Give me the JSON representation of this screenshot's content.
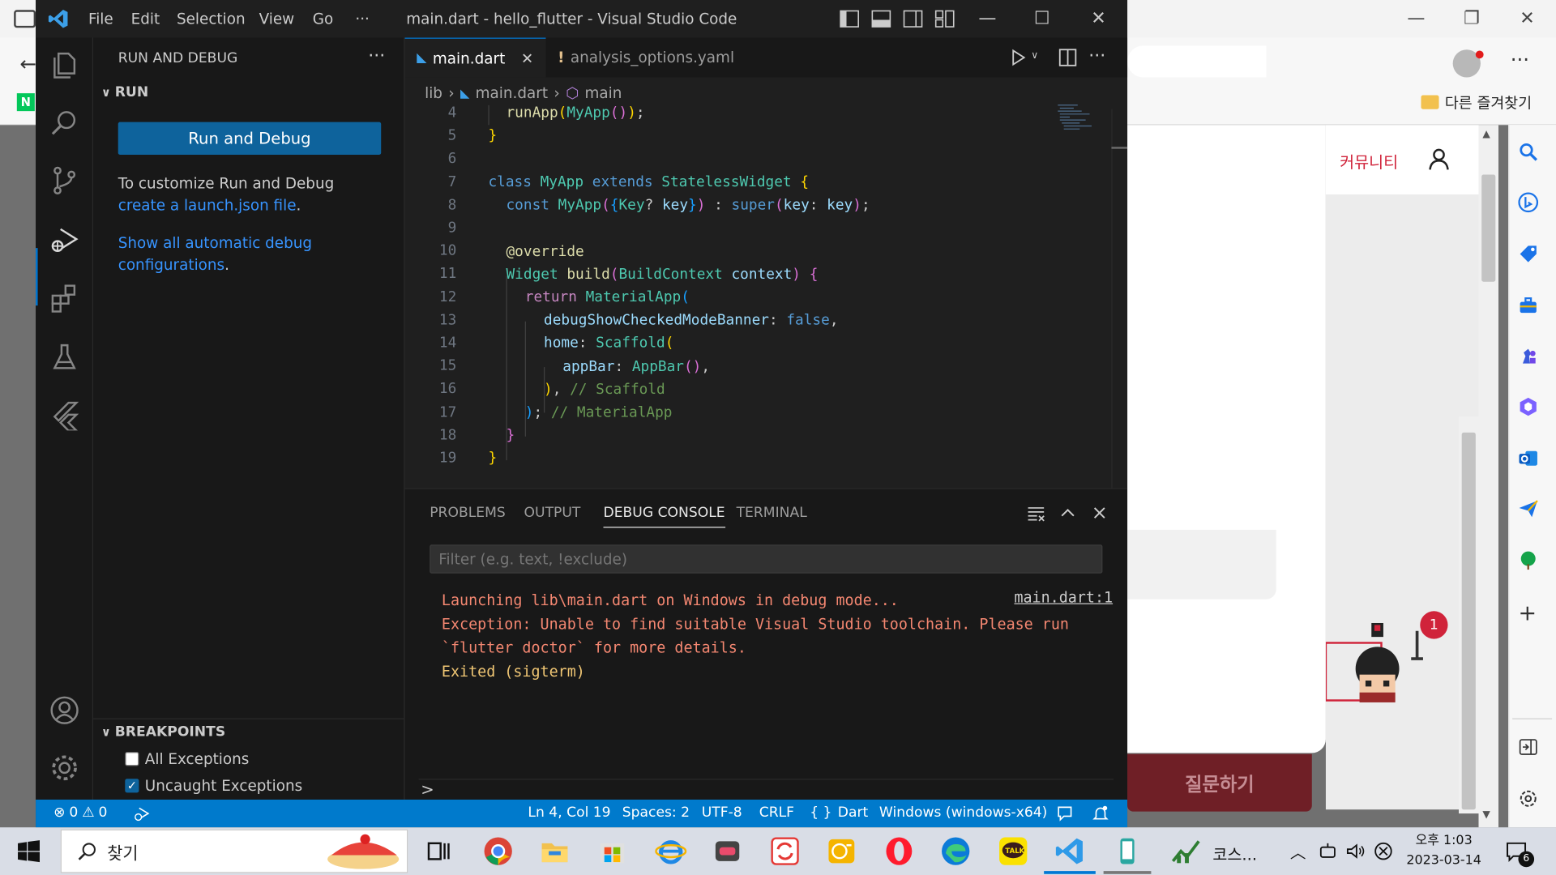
{
  "edge": {
    "favorites_folder": "다른 즐겨찾기",
    "site": {
      "community_label": "커뮤니티",
      "ask_button": "질문하기",
      "notification_count": "1"
    },
    "n_badge": "N"
  },
  "vscode": {
    "title": "main.dart - hello_flutter - Visual Studio Code",
    "menu": [
      "File",
      "Edit",
      "Selection",
      "View",
      "Go",
      "···"
    ],
    "sidebar": {
      "title": "RUN AND DEBUG",
      "run_section": "RUN",
      "run_button": "Run and Debug",
      "desc_prefix": "To customize Run and Debug ",
      "desc_link": "create a launch.json file",
      "desc_suffix": ".",
      "show_all_link": "Show all automatic debug configurations",
      "show_all_suffix": ".",
      "breakpoints_section": "BREAKPOINTS",
      "breakpoints": [
        {
          "label": "All Exceptions",
          "checked": false
        },
        {
          "label": "Uncaught Exceptions",
          "checked": true
        }
      ]
    },
    "tabs": [
      {
        "label": "main.dart",
        "active": true
      },
      {
        "label": "analysis_options.yaml",
        "active": false
      }
    ],
    "breadcrumbs": [
      "lib",
      "main.dart",
      "main"
    ],
    "code_lines": [
      {
        "n": "4"
      },
      {
        "n": "5"
      },
      {
        "n": "6"
      },
      {
        "n": "7"
      },
      {
        "n": "8"
      },
      {
        "n": "9"
      },
      {
        "n": "10"
      },
      {
        "n": "11"
      },
      {
        "n": "12"
      },
      {
        "n": "13"
      },
      {
        "n": "14"
      },
      {
        "n": "15"
      },
      {
        "n": "16"
      },
      {
        "n": "17"
      },
      {
        "n": "18"
      },
      {
        "n": "19"
      }
    ],
    "code_text": {
      "l4": "runApp",
      "l4b": "MyApp",
      "l7_class": "class",
      "l7_name": "MyApp",
      "l7_ext": "extends",
      "l7_base": "StatelessWidget",
      "l8_const": "const",
      "l8_name": "MyApp",
      "l8_key_type": "Key",
      "l8_key": "key",
      "l8_super": "super",
      "l8_key2": "key",
      "l8_key3": "key",
      "l10": "@override",
      "l11_type": "Widget",
      "l11_fn": "build",
      "l11_ptype": "BuildContext",
      "l11_param": "context",
      "l12_ret": "return",
      "l12_fn": "MaterialApp",
      "l13_prop": "debugShowCheckedModeBanner",
      "l13_val": "false",
      "l14_prop": "home",
      "l14_fn": "Scaffold",
      "l15_prop": "appBar",
      "l15_fn": "AppBar",
      "l16_cm": "// Scaffold",
      "l17_cm": "// MaterialApp"
    },
    "panel": {
      "tabs": [
        "PROBLEMS",
        "OUTPUT",
        "DEBUG CONSOLE",
        "TERMINAL"
      ],
      "active_tab": "DEBUG CONSOLE",
      "filter_placeholder": "Filter (e.g. text, !exclude)",
      "console_lines": [
        "Launching lib\\main.dart on Windows in debug mode...",
        "Exception: Unable to find suitable Visual Studio toolchain. Please run",
        "`flutter doctor` for more details.",
        "Exited (sigterm)"
      ],
      "console_source": "main.dart:1",
      "prompt": ">"
    },
    "status": {
      "errors": "0",
      "warnings": "0",
      "position": "Ln 4, Col 19",
      "spaces": "Spaces: 2",
      "encoding": "UTF-8",
      "eol": "CRLF",
      "language": "Dart",
      "device": "Windows (windows-x64)"
    }
  },
  "taskbar": {
    "search_label": "찾기",
    "tray_app_label": "코스...",
    "clock_time": "오후 1:03",
    "clock_date": "2023-03-14",
    "notification_count": "6"
  },
  "colors": {
    "vscode_accent": "#007acc",
    "run_button": "#0e639c",
    "error_text": "#f48771",
    "site_red": "#d0233a"
  }
}
